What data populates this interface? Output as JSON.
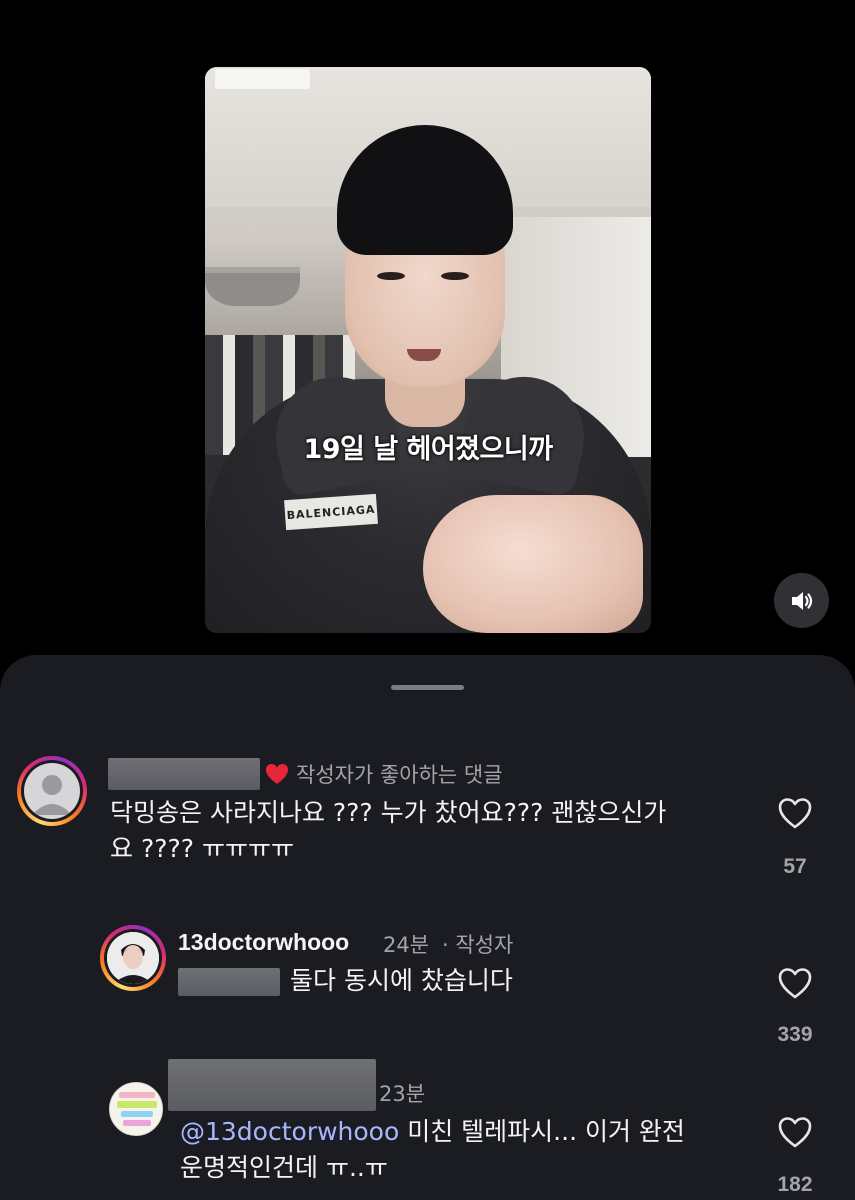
{
  "video": {
    "caption": "19일 날 헤어졌으니까",
    "hoodie_logo": "BALENCIAGA"
  },
  "controls": {
    "sound_icon": "speaker-icon"
  },
  "comments": [
    {
      "author_liked_label": "작성자가 좋아하는 댓글",
      "text_line1": "닥밍송은 사라지나요 ??? 누가 찼어요??? 괜찮으신가",
      "text_line2": "요 ???? ㅠㅠㅠㅠ",
      "likes": "57"
    },
    {
      "username": "13doctorwhooo",
      "time": "24분",
      "author_badge": "· 작성자",
      "text": "둘다 동시에 찼습니다",
      "likes": "339"
    },
    {
      "time": "23분",
      "mention": "@13doctorwhooo",
      "text_line1": " 미친 텔레파시... 이거 완전",
      "text_line2": "운명적인건데 ㅠ..ㅠ",
      "likes": "182"
    }
  ],
  "colors": {
    "sheet_bg": "#1b1c21",
    "liked_heart": "#e8263a",
    "mention": "#a9b6ff",
    "muted_text": "#a3a4a9"
  }
}
